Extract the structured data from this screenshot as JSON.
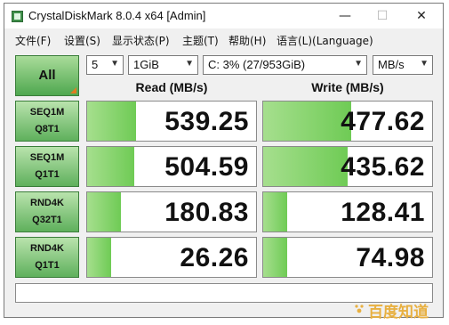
{
  "window": {
    "title": "CrystalDiskMark 8.0.4 x64 [Admin]",
    "minimize_glyph": "—",
    "maximize_glyph": "☐",
    "close_glyph": "✕"
  },
  "menu": [
    "文件(F)",
    "设置(S)",
    "显示状态(P)",
    "主题(T)",
    "帮助(H)",
    "语言(L)(Language)"
  ],
  "controls": {
    "all_label": "All",
    "count": "5",
    "size": "1GiB",
    "drive": "C: 3% (27/953GiB)",
    "unit": "MB/s"
  },
  "headers": {
    "read": "Read (MB/s)",
    "write": "Write (MB/s)"
  },
  "tests": [
    {
      "line1": "SEQ1M",
      "line2": "Q8T1",
      "read": "539.25",
      "write": "477.62",
      "read_fill": 0.29,
      "write_fill": 0.52
    },
    {
      "line1": "SEQ1M",
      "line2": "Q1T1",
      "read": "504.59",
      "write": "435.62",
      "read_fill": 0.28,
      "write_fill": 0.5
    },
    {
      "line1": "RND4K",
      "line2": "Q32T1",
      "read": "180.83",
      "write": "128.41",
      "read_fill": 0.2,
      "write_fill": 0.14
    },
    {
      "line1": "RND4K",
      "line2": "Q1T1",
      "read": "26.26",
      "write": "74.98",
      "read_fill": 0.14,
      "write_fill": 0.14
    }
  ],
  "comment": "",
  "watermark": "百度知道",
  "colors": {
    "accent_green": "#6fcb55",
    "button_green": "#5fb05c",
    "triangle": "#e07b1f"
  }
}
